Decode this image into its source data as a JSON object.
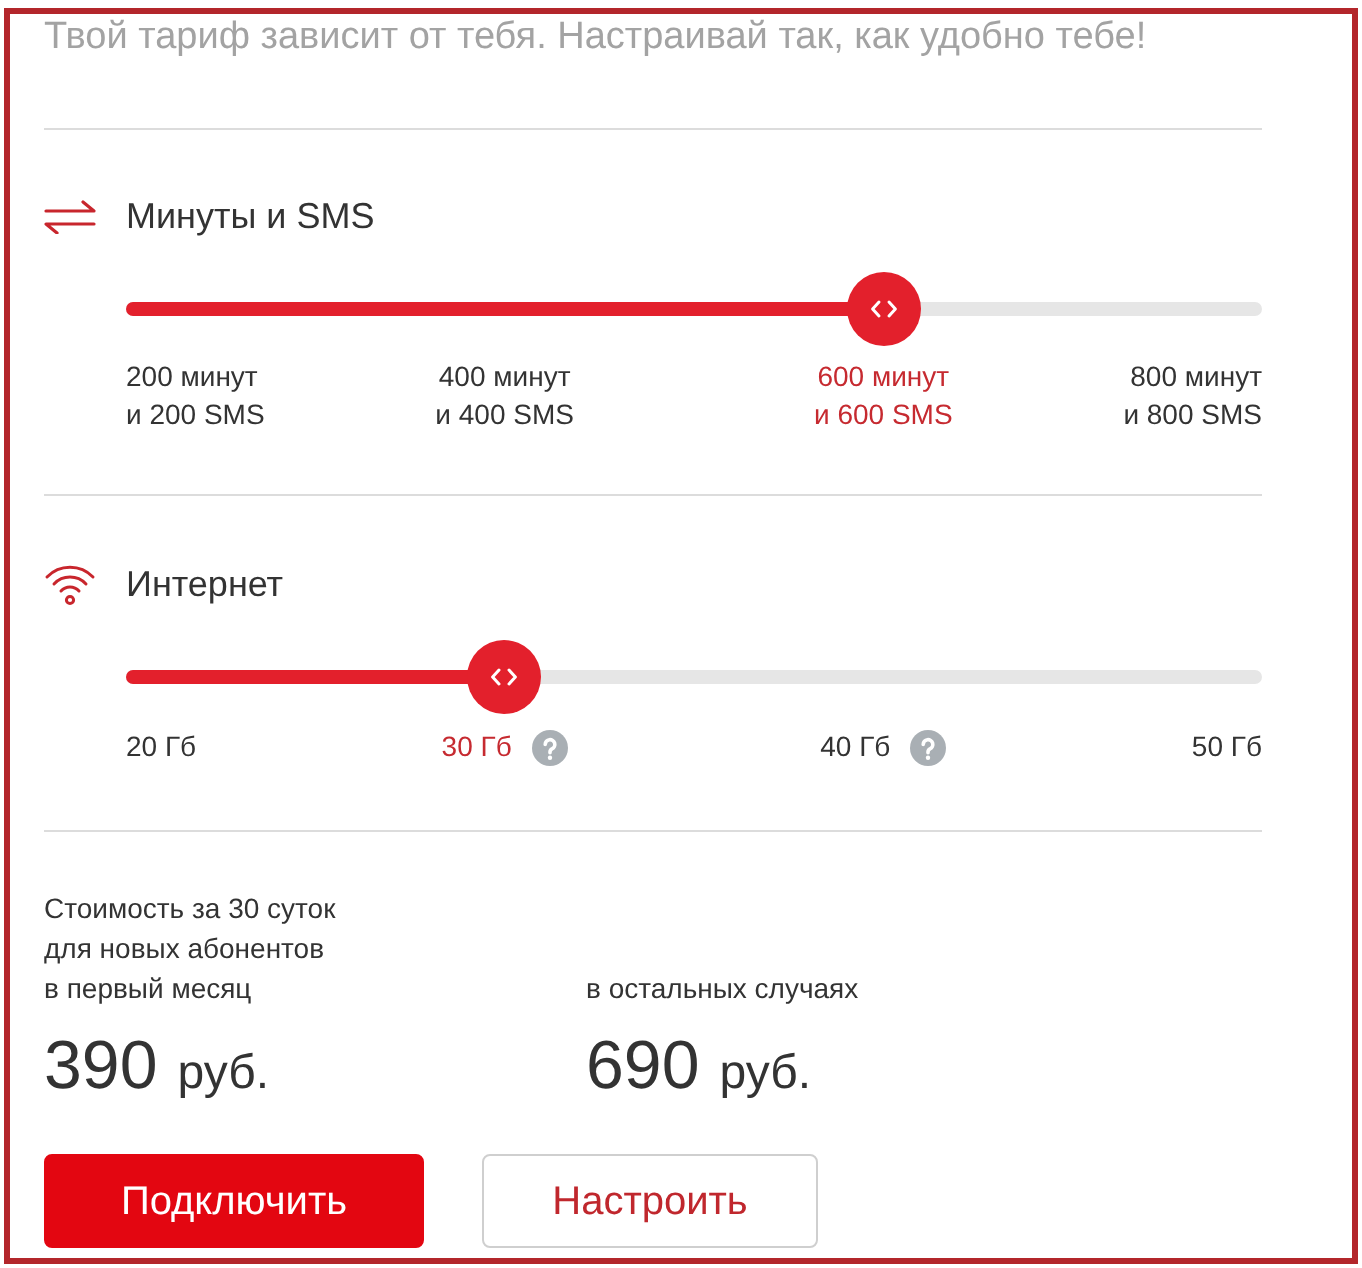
{
  "intro": "Твой тариф зависит от тебя. Настраивай так, как удобно тебе!",
  "sliders": [
    {
      "kind": "calls",
      "label": "Минуты и SMS",
      "level": 0.667,
      "ticks": [
        {
          "label": "200 минут\nи 200 SMS",
          "selected": false
        },
        {
          "label": "400 минут\nи 400 SMS",
          "selected": false
        },
        {
          "label": "600 минут\nи 600 SMS",
          "selected": true
        },
        {
          "label": "800 минут\nи 800 SMS",
          "selected": false
        }
      ]
    },
    {
      "kind": "internet",
      "label": "Интернет",
      "level": 0.333,
      "ticks": [
        {
          "label": "20 Гб",
          "selected": false,
          "help": false
        },
        {
          "label": "30 Гб",
          "selected": true,
          "help": true
        },
        {
          "label": "40 Гб",
          "selected": false,
          "help": true
        },
        {
          "label": "50 Гб",
          "selected": false,
          "help": false
        }
      ]
    }
  ],
  "prices": [
    {
      "caption": "Стоимость за 30 суток\nдля новых абонентов\nв первый месяц",
      "amount": "390",
      "currency": "руб."
    },
    {
      "caption": "в остальных случаях",
      "amount": "690",
      "currency": "руб."
    }
  ],
  "buttons": [
    {
      "kind": "primary",
      "label": "Подключить"
    },
    {
      "kind": "secondary",
      "label": "Настроить"
    }
  ]
}
